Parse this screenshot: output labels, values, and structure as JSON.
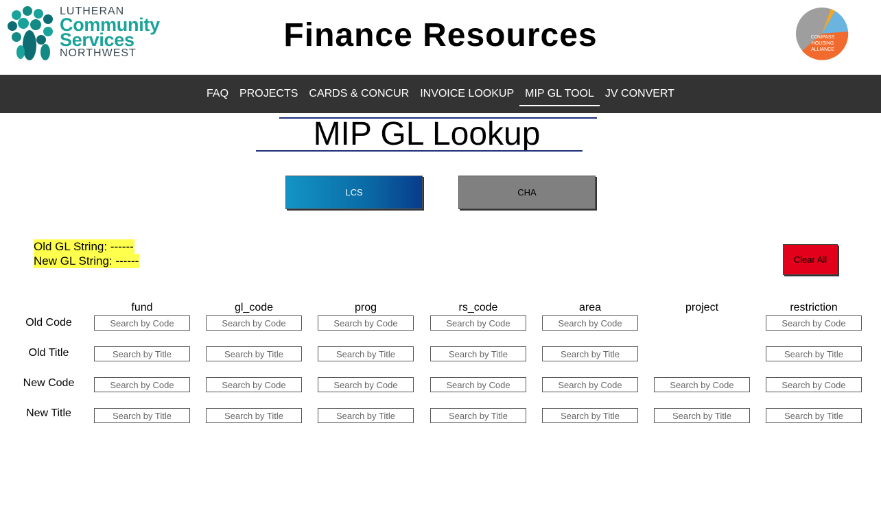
{
  "header": {
    "title": "Finance Resources",
    "lcs_logo": {
      "line1": "LUTHERAN",
      "line2": "Community",
      "line3": "Services",
      "line4": "NORTHWEST",
      "icon": "lcs-tree-logo"
    },
    "cha_logo": {
      "line1": "COMPASS",
      "line2": "HOUSING",
      "line3": "ALLIANCE",
      "icon": "cha-circle-logo"
    }
  },
  "nav": {
    "items": [
      {
        "label": "FAQ"
      },
      {
        "label": "PROJECTS"
      },
      {
        "label": "CARDS & CONCUR"
      },
      {
        "label": "INVOICE LOOKUP"
      },
      {
        "label": "MIP GL TOOL"
      },
      {
        "label": "JV CONVERT"
      }
    ],
    "active": "MIP GL TOOL"
  },
  "main": {
    "title": "MIP GL Lookup",
    "org_buttons": {
      "lcs": "LCS",
      "cha": "CHA"
    },
    "old_gl_string": "Old GL String: ------",
    "new_gl_string": "New GL String: ------",
    "clear_label": "Clear All",
    "columns": [
      "fund",
      "gl_code",
      "prog",
      "rs_code",
      "area",
      "project",
      "restriction"
    ],
    "rows": [
      "Old Code",
      "Old Title",
      "New Code",
      "New Title"
    ],
    "code_placeholder": "Search by Code",
    "title_placeholder": "Search by Title"
  },
  "colors": {
    "nav_bg": "#333333",
    "lcs_teal": "#1aa39a",
    "clear_red": "#e3001b",
    "highlight": "#ffff4d",
    "cha_orange": "#f26b2e"
  }
}
